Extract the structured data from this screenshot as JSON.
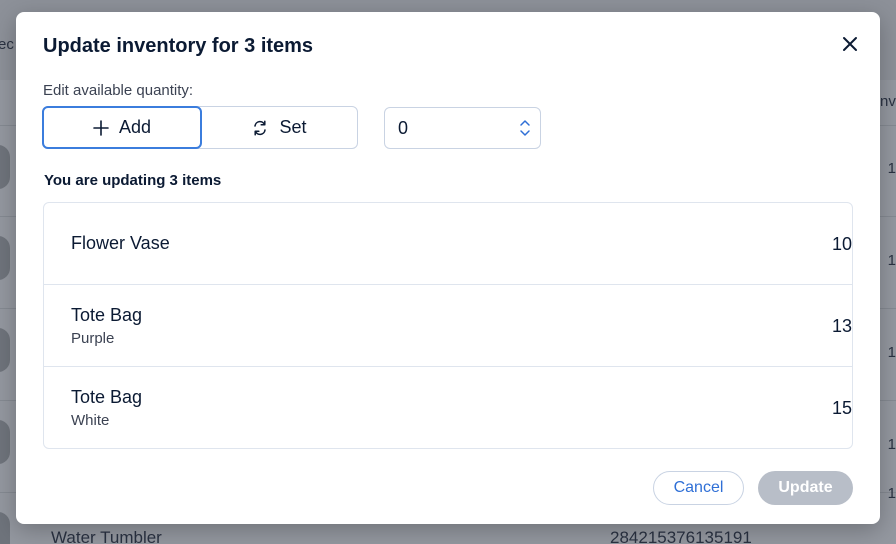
{
  "background": {
    "partial_header_left": "ec",
    "partial_header_right": "nv",
    "partial_row_text": "Water Tumbler",
    "partial_row_number": "284215376135191",
    "right_edge_digits": [
      "1",
      "1",
      "1",
      "1",
      "1"
    ]
  },
  "modal": {
    "title": "Update inventory for 3 items",
    "close_icon": "close-icon",
    "edit_label": "Edit available quantity:",
    "mode": {
      "add_label": "Add",
      "add_icon": "plus-icon",
      "set_label": "Set",
      "set_icon": "sync-icon",
      "selected": "Add"
    },
    "quantity_value": "0",
    "section_title": "You are updating 3 items",
    "items": [
      {
        "name": "Flower Vase",
        "variant": "",
        "quantity": "10"
      },
      {
        "name": "Tote Bag",
        "variant": "Purple",
        "quantity": "13"
      },
      {
        "name": "Tote Bag",
        "variant": "White",
        "quantity": "15"
      }
    ],
    "cancel_label": "Cancel",
    "update_label": "Update"
  },
  "colors": {
    "accent": "#3b7ddd",
    "link": "#2f6fd6",
    "disabled_button": "#b8bec8",
    "overlay": "#9498a0"
  }
}
